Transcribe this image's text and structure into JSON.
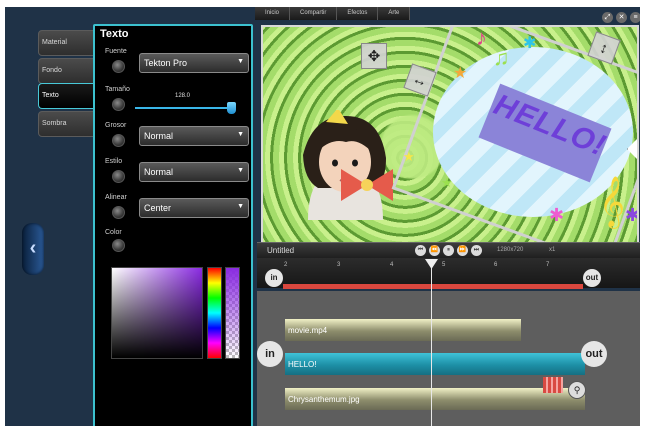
{
  "menu": {
    "items": [
      "Inicio",
      "Compartir",
      "Efectos",
      "Arte"
    ]
  },
  "window_controls": {
    "resize": "⤢",
    "close": "✕",
    "menu": "≡"
  },
  "sidebar": {
    "tabs": [
      {
        "label": "Material"
      },
      {
        "label": "Fondo"
      },
      {
        "label": "Texto"
      },
      {
        "label": "Sombra"
      }
    ],
    "back_icon": "‹"
  },
  "panel": {
    "title": "Texto",
    "font": {
      "label": "Fuente",
      "value": "Tekton Pro"
    },
    "size": {
      "label": "Tamaño",
      "value": "128.0",
      "level": 0.94
    },
    "weight": {
      "label": "Grosor",
      "value": "Normal"
    },
    "style": {
      "label": "Estilo",
      "value": "Normal"
    },
    "align": {
      "label": "Alinear",
      "value": "Center"
    },
    "color": {
      "label": "Color",
      "accent": "#8a2be2"
    }
  },
  "preview": {
    "overlay_text": "HELLO!",
    "handles": {
      "move": "✥",
      "horizontal": "↔",
      "vertical": "↕"
    }
  },
  "timeline": {
    "project_name": "Untitled",
    "controls": [
      "⏮",
      "⏪",
      "⏸",
      "⏩",
      "⏭"
    ],
    "resolution": "1280x720",
    "speed": "x1",
    "ruler_ticks": [
      "2",
      "3",
      "4",
      "5",
      "6",
      "7"
    ],
    "in_label": "in",
    "out_label": "out",
    "clips": [
      {
        "name": "movie.mp4"
      },
      {
        "name": "HELLO!"
      },
      {
        "name": "Chrysanthemum.jpg"
      }
    ]
  }
}
